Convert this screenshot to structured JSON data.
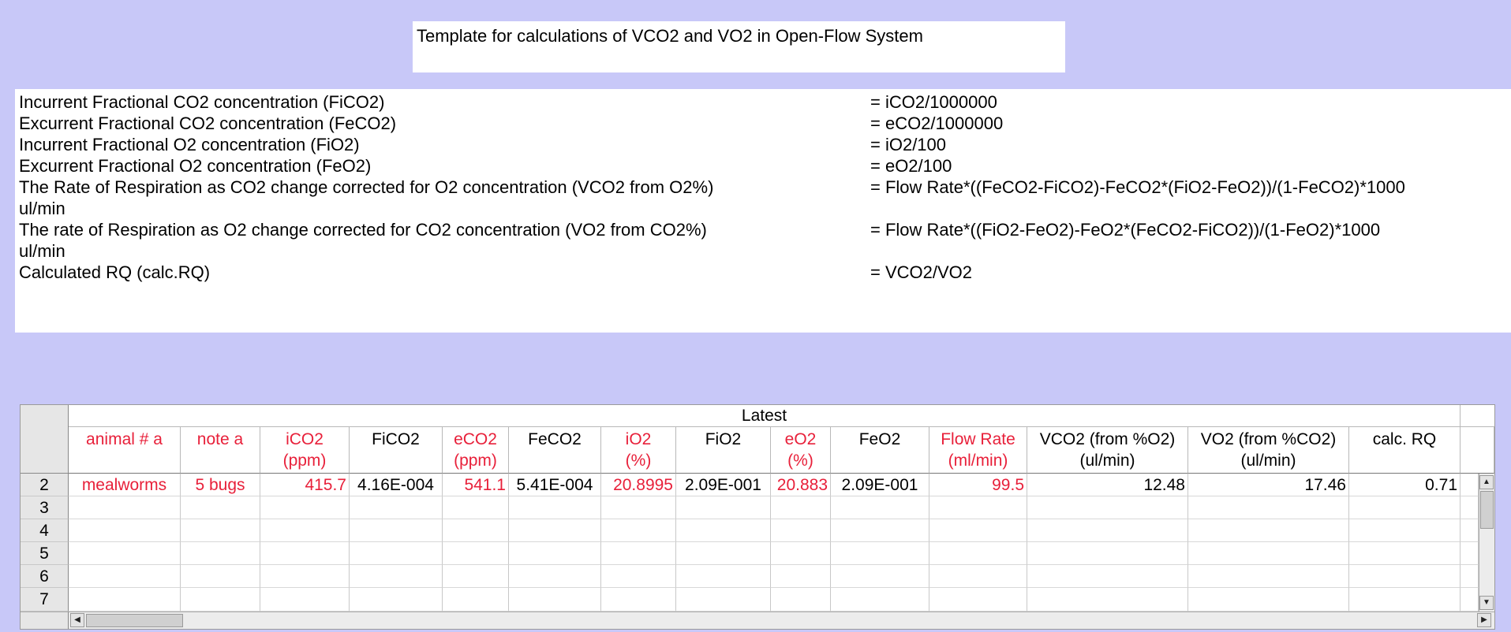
{
  "title": "Template for calculations of VCO2 and VO2 in Open-Flow System",
  "formulas": [
    {
      "label": "Incurrent Fractional CO2 concentration (FiCO2)",
      "expr": "= iCO2/1000000"
    },
    {
      "label": "Excurrent Fractional CO2 concentration (FeCO2)",
      "expr": "= eCO2/1000000"
    },
    {
      "label": "Incurrent Fractional O2 concentration (FiO2)",
      "expr": "= iO2/100"
    },
    {
      "label": "Excurrent Fractional O2 concentration (FeO2)",
      "expr": "= eO2/100"
    },
    {
      "label": "The Rate of Respiration as CO2 change corrected for O2 concentration (VCO2 from O2%)",
      "label2": "ul/min",
      "expr": "= Flow Rate*((FeCO2-FiCO2)-FeCO2*(FiO2-FeO2))/(1-FeCO2)*1000"
    },
    {
      "label": "The rate of Respiration as O2 change corrected for CO2 concentration (VO2 from CO2%)",
      "label2": "ul/min",
      "expr": "= Flow Rate*((FiO2-FeO2)-FeO2*(FeCO2-FiCO2))/(1-FeO2)*1000"
    },
    {
      "label": "Calculated RQ (calc.RQ)",
      "expr": "= VCO2/VO2"
    }
  ],
  "grid": {
    "group_header": "Latest",
    "columns": [
      {
        "line1": "animal # a",
        "line2": "",
        "color": "red"
      },
      {
        "line1": "note a",
        "line2": "",
        "color": "red"
      },
      {
        "line1": "iCO2",
        "line2": "(ppm)",
        "color": "red"
      },
      {
        "line1": "FiCO2",
        "line2": "",
        "color": "black"
      },
      {
        "line1": "eCO2",
        "line2": "(ppm)",
        "color": "red"
      },
      {
        "line1": "FeCO2",
        "line2": "",
        "color": "black"
      },
      {
        "line1": "iO2",
        "line2": "(%)",
        "color": "red"
      },
      {
        "line1": "FiO2",
        "line2": "",
        "color": "black"
      },
      {
        "line1": "eO2",
        "line2": "(%)",
        "color": "red"
      },
      {
        "line1": "FeO2",
        "line2": "",
        "color": "black"
      },
      {
        "line1": "Flow Rate",
        "line2": "(ml/min)",
        "color": "red"
      },
      {
        "line1": "VCO2 (from %O2)",
        "line2": "(ul/min)",
        "color": "black"
      },
      {
        "line1": "VO2 (from %CO2)",
        "line2": "(ul/min)",
        "color": "black"
      },
      {
        "line1": "calc. RQ",
        "line2": "",
        "color": "black"
      }
    ],
    "row_numbers": [
      "2",
      "3",
      "4",
      "5",
      "6",
      "7"
    ],
    "rows": [
      [
        "mealworms",
        "5 bugs",
        "415.7",
        "4.16E-004",
        "541.1",
        "5.41E-004",
        "20.8995",
        "2.09E-001",
        "20.883",
        "2.09E-001",
        "99.5",
        "12.48",
        "17.46",
        "0.71"
      ]
    ]
  },
  "colors": {
    "background": "#c8c8f8",
    "input_text": "#e8203a"
  }
}
